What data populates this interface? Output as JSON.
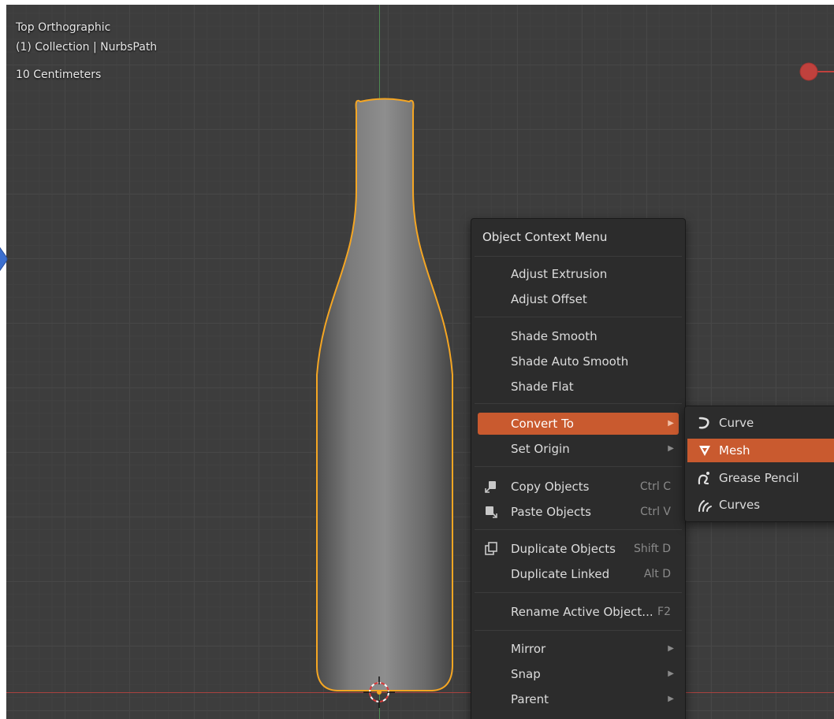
{
  "viewport": {
    "view_name": "Top Orthographic",
    "collection_info": "(1) Collection | NurbsPath",
    "scale_label": "10 Centimeters"
  },
  "context_menu": {
    "title": "Object Context Menu",
    "items": [
      {
        "label": "Adjust Extrusion"
      },
      {
        "label": "Adjust Offset"
      },
      {
        "label": "Shade Smooth"
      },
      {
        "label": "Shade Auto Smooth"
      },
      {
        "label": "Shade Flat"
      },
      {
        "label": "Convert To",
        "highlighted": true
      },
      {
        "label": "Set Origin"
      },
      {
        "label": "Copy Objects",
        "shortcut": "Ctrl C",
        "icon": "copy-icon"
      },
      {
        "label": "Paste Objects",
        "shortcut": "Ctrl V",
        "icon": "paste-icon"
      },
      {
        "label": "Duplicate Objects",
        "shortcut": "Shift D",
        "icon": "duplicate-icon"
      },
      {
        "label": "Duplicate Linked",
        "shortcut": "Alt D"
      },
      {
        "label": "Rename Active Object...",
        "shortcut": "F2"
      },
      {
        "label": "Mirror"
      },
      {
        "label": "Snap"
      },
      {
        "label": "Parent"
      }
    ]
  },
  "convert_submenu": {
    "items": [
      {
        "label": "Curve",
        "icon": "curve-icon"
      },
      {
        "label": "Mesh",
        "icon": "mesh-icon",
        "highlighted": true
      },
      {
        "label": "Grease Pencil",
        "icon": "grease-pencil-icon"
      },
      {
        "label": "Curves",
        "icon": "curves-icon"
      }
    ]
  },
  "colors": {
    "selection_outline": "#f5a623",
    "highlight": "#c95a2f",
    "menu_bg": "#2c2c2c",
    "viewport_bg": "#3d3d3d"
  }
}
